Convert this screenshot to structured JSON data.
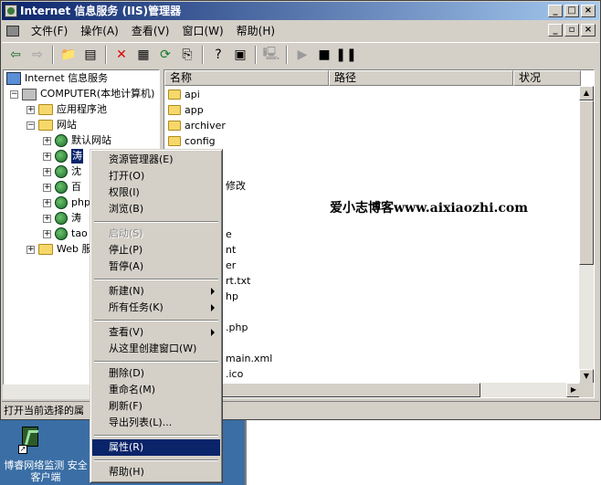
{
  "window": {
    "title": "Internet 信息服务 (IIS)管理器",
    "title_buttons": [
      "_",
      "□",
      "×"
    ]
  },
  "menubar": {
    "items": [
      "文件(F)",
      "操作(A)",
      "查看(V)",
      "窗口(W)",
      "帮助(H)"
    ],
    "mdi_buttons": [
      "_",
      "▫",
      "×"
    ]
  },
  "toolbar": {
    "icons": [
      "back-icon",
      "forward-icon",
      "up-folder-icon",
      "show-tree-icon",
      "delete-icon",
      "properties-icon",
      "refresh-icon",
      "export-icon",
      "help-icon",
      "console-icon",
      "computer-icon",
      "play-icon",
      "stop-icon",
      "pause-icon"
    ]
  },
  "tree": {
    "root": "Internet 信息服务",
    "computer": "COMPUTER(本地计算机)",
    "app_pool": "应用程序池",
    "websites": "网站",
    "sites": [
      "默认网站",
      "涛",
      "沈",
      "百",
      "php",
      "涛",
      "tao"
    ],
    "web_ext": "Web 服"
  },
  "list": {
    "columns": [
      "名称",
      "路径",
      "状况"
    ],
    "rows": [
      "api",
      "app",
      "archiver",
      "config",
      "修改",
      "e",
      "nt",
      "er",
      "rt.txt",
      "hp",
      ".php",
      "main.xml",
      ".ico"
    ]
  },
  "status": "打开当前选择的属",
  "watermark": "爱小志博客www.aixiaozhi.com",
  "context_menu": {
    "groups": [
      [
        {
          "label": "资源管理器(E)"
        },
        {
          "label": "打开(O)"
        },
        {
          "label": "权限(I)"
        },
        {
          "label": "浏览(B)"
        }
      ],
      [
        {
          "label": "启动(S)",
          "disabled": true
        },
        {
          "label": "停止(P)"
        },
        {
          "label": "暂停(A)"
        }
      ],
      [
        {
          "label": "新建(N)",
          "submenu": true
        },
        {
          "label": "所有任务(K)",
          "submenu": true
        }
      ],
      [
        {
          "label": "查看(V)",
          "submenu": true
        },
        {
          "label": "从这里创建窗口(W)"
        }
      ],
      [
        {
          "label": "删除(D)"
        },
        {
          "label": "重命名(M)"
        },
        {
          "label": "刷新(F)"
        },
        {
          "label": "导出列表(L)..."
        }
      ],
      [
        {
          "label": "属性(R)",
          "highlight": true
        }
      ],
      [
        {
          "label": "帮助(H)"
        }
      ]
    ]
  },
  "desktop": {
    "icon_label_line1": "博睿网络监测 安全",
    "icon_label_line2": "客户端"
  }
}
